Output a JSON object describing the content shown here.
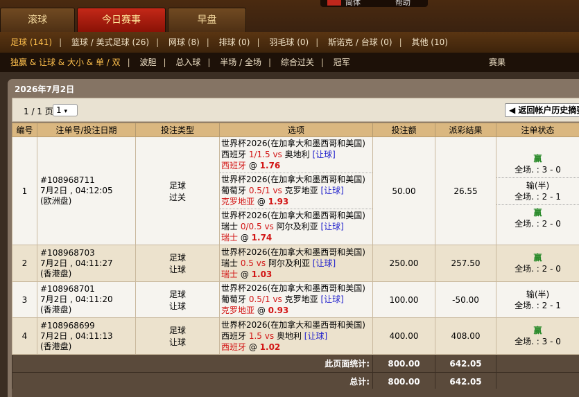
{
  "tabs": [
    {
      "label": "滚球"
    },
    {
      "label": "今日赛事"
    },
    {
      "label": "早盘"
    }
  ],
  "top_right": {
    "a": "简体",
    "b": "帮助"
  },
  "sports": [
    {
      "label": "足球 (141)"
    },
    {
      "label": "篮球 / 美式足球 (26)"
    },
    {
      "label": "网球 (8)"
    },
    {
      "label": "排球 (0)"
    },
    {
      "label": "羽毛球 (0)"
    },
    {
      "label": "斯诺克 / 台球 (0)"
    },
    {
      "label": "其他 (10)"
    }
  ],
  "bet_types": [
    {
      "label": "独赢 & 让球 & 大小 & 单 / 双"
    },
    {
      "label": "波胆"
    },
    {
      "label": "总入球"
    },
    {
      "label": "半场 / 全场"
    },
    {
      "label": "综合过关"
    },
    {
      "label": "冠军"
    }
  ],
  "results_label": "赛果",
  "panel_title": "2026年7月2日",
  "pager": {
    "text": "1 / 1 页",
    "select": "1",
    "back": "返回帐户历史摘要"
  },
  "headers": [
    "编号",
    "注单号/投注日期",
    "投注类型",
    "选项",
    "投注额",
    "派彩结果",
    "注单状态"
  ],
  "rows": [
    {
      "no": "1",
      "ticket": "#108968711",
      "date": "7月2日 , 04:12:05",
      "odds_type": "(欧洲盘)",
      "type1": "足球",
      "type2": "过关",
      "stake": "50.00",
      "result": "26.55",
      "legs": [
        {
          "league": "世界杯2026(在加拿大和墨西哥和美国)",
          "home": "西班牙",
          "hdp": "1/1.5",
          "vs": "vs",
          "away": "奥地利",
          "mkt": "[让球]",
          "pick": "西班牙",
          "at": "@",
          "odds": "1.76"
        },
        {
          "league": "世界杯2026(在加拿大和墨西哥和美国)",
          "home": "葡萄牙",
          "hdp": "0.5/1",
          "vs": "vs",
          "away": "克罗地亚",
          "mkt": "[让球]",
          "pick": "克罗地亚",
          "at": "@",
          "odds": "1.93"
        },
        {
          "league": "世界杯2026(在加拿大和墨西哥和美国)",
          "home": "瑞士",
          "hdp": "0/0.5",
          "vs": "vs",
          "away": "阿尔及利亚",
          "mkt": "[让球]",
          "pick": "瑞士",
          "at": "@",
          "odds": "1.74"
        }
      ],
      "status": [
        {
          "s": "赢",
          "score": "全场. : 3 - 0",
          "win": true
        },
        {
          "s": "输(半)",
          "score": "全场. : 2 - 1",
          "win": false
        },
        {
          "s": "赢",
          "score": "全场. : 2 - 0",
          "win": true
        }
      ]
    },
    {
      "no": "2",
      "ticket": "#108968703",
      "date": "7月2日 , 04:11:27",
      "odds_type": "(香港盘)",
      "type1": "足球",
      "type2": "让球",
      "stake": "250.00",
      "result": "257.50",
      "legs": [
        {
          "league": "世界杯2026(在加拿大和墨西哥和美国)",
          "home": "瑞士",
          "hdp": "0.5",
          "vs": "vs",
          "away": "阿尔及利亚",
          "mkt": "[让球]",
          "pick": "瑞士",
          "at": "@",
          "odds": "1.03"
        }
      ],
      "status": [
        {
          "s": "赢",
          "score": "全场. : 2 - 0",
          "win": true
        }
      ]
    },
    {
      "no": "3",
      "ticket": "#108968701",
      "date": "7月2日 , 04:11:20",
      "odds_type": "(香港盘)",
      "type1": "足球",
      "type2": "让球",
      "stake": "100.00",
      "result": "-50.00",
      "legs": [
        {
          "league": "世界杯2026(在加拿大和墨西哥和美国)",
          "home": "葡萄牙",
          "hdp": "0.5/1",
          "vs": "vs",
          "away": "克罗地亚",
          "mkt": "[让球]",
          "pick": "克罗地亚",
          "at": "@",
          "odds": "0.93"
        }
      ],
      "status": [
        {
          "s": "输(半)",
          "score": "全场. : 2 - 1",
          "win": false
        }
      ]
    },
    {
      "no": "4",
      "ticket": "#108968699",
      "date": "7月2日 , 04:11:13",
      "odds_type": "(香港盘)",
      "type1": "足球",
      "type2": "让球",
      "stake": "400.00",
      "result": "408.00",
      "legs": [
        {
          "league": "世界杯2026(在加拿大和墨西哥和美国)",
          "home": "西班牙",
          "hdp": "1.5",
          "vs": "vs",
          "away": "奥地利",
          "mkt": "[让球]",
          "pick": "西班牙",
          "at": "@",
          "odds": "1.02"
        }
      ],
      "status": [
        {
          "s": "赢",
          "score": "全场. : 3 - 0",
          "win": true
        }
      ]
    }
  ],
  "totals": [
    {
      "label": "此页面统计:",
      "stake": "800.00",
      "result": "642.05"
    },
    {
      "label": "总计:",
      "stake": "800.00",
      "result": "642.05"
    }
  ]
}
